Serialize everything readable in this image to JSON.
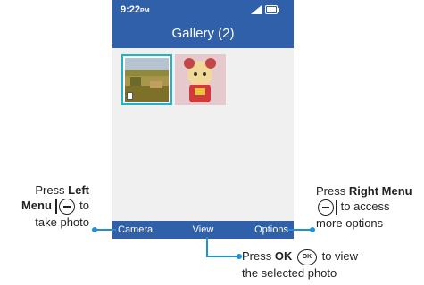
{
  "status": {
    "time": "9:22",
    "ampm": "PM"
  },
  "header": {
    "title": "Gallery (2)"
  },
  "softkeys": {
    "left": "Camera",
    "center": "View",
    "right": "Options"
  },
  "callouts": {
    "left": {
      "line1_prefix": "Press ",
      "line1_bold": "Left",
      "line2_bold": "Menu",
      "line2_suffix": " to",
      "line3": "take photo"
    },
    "right": {
      "line1_prefix": "Press ",
      "line1_bold": "Right Menu",
      "line2_suffix": " to access",
      "line3": "more options"
    },
    "ok": {
      "line1_prefix": "Press ",
      "line1_bold": "OK",
      "line1_suffix": " to view",
      "line2": "the selected photo",
      "key_label": "OK"
    }
  },
  "colors": {
    "brand": "#2f60a9",
    "highlight": "#1fb3c8",
    "callout_line": "#1e90d6"
  }
}
